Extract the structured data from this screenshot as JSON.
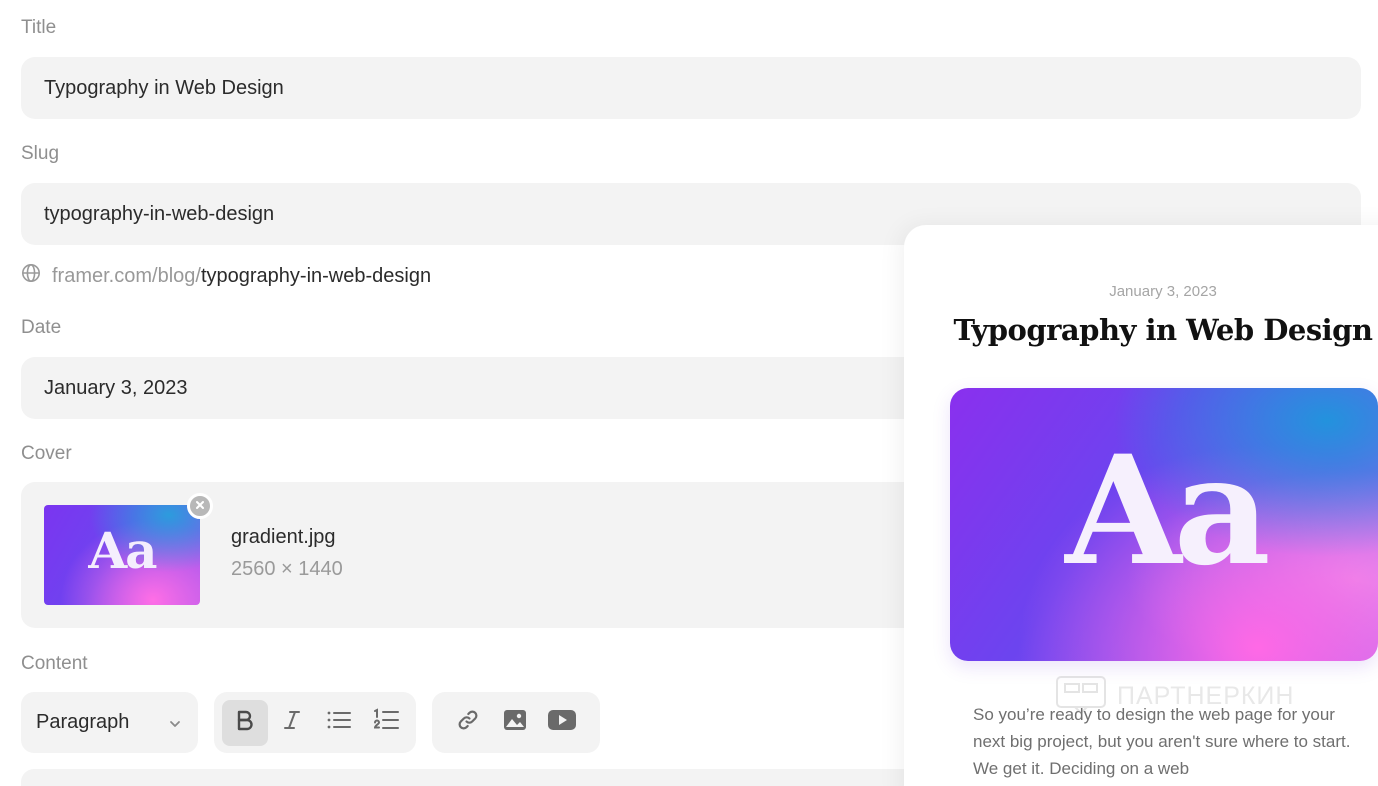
{
  "form": {
    "title_label": "Title",
    "title_value": "Typography in Web Design",
    "slug_label": "Slug",
    "slug_value": "typography-in-web-design",
    "url_prefix": "framer.com/blog/",
    "url_slug": "typography-in-web-design",
    "date_label": "Date",
    "date_value": "January 3, 2023",
    "cover_label": "Cover",
    "cover_thumb_text": "Aa",
    "cover_file_name": "gradient.jpg",
    "cover_file_size": "2560 × 1440",
    "content_label": "Content"
  },
  "toolbar": {
    "block_type": "Paragraph",
    "format_buttons": [
      {
        "name": "bold",
        "icon": "bold-icon",
        "active": true
      },
      {
        "name": "italic",
        "icon": "italic-icon",
        "active": false
      },
      {
        "name": "bulleted-list",
        "icon": "bulleted-list-icon",
        "active": false
      },
      {
        "name": "numbered-list",
        "icon": "numbered-list-icon",
        "active": false
      }
    ],
    "insert_buttons": [
      {
        "name": "link",
        "icon": "link-icon"
      },
      {
        "name": "image",
        "icon": "image-icon"
      },
      {
        "name": "video",
        "icon": "video-icon"
      }
    ]
  },
  "preview": {
    "date": "January 3, 2023",
    "title": "Typography in Web Design",
    "hero_text": "Aa",
    "body": "So you’re ready to design the web page for your next big project, but you aren't sure where to start. We get it. Deciding on a web"
  },
  "watermark": {
    "text": "ПАРТНЕРКИН"
  },
  "colors": {
    "field_bg": "#f3f3f3",
    "label_text": "#8f8f8f",
    "gradient_purple": "#7b35f0",
    "gradient_pink": "#ff6ee6",
    "gradient_blue": "#28a0dc"
  }
}
